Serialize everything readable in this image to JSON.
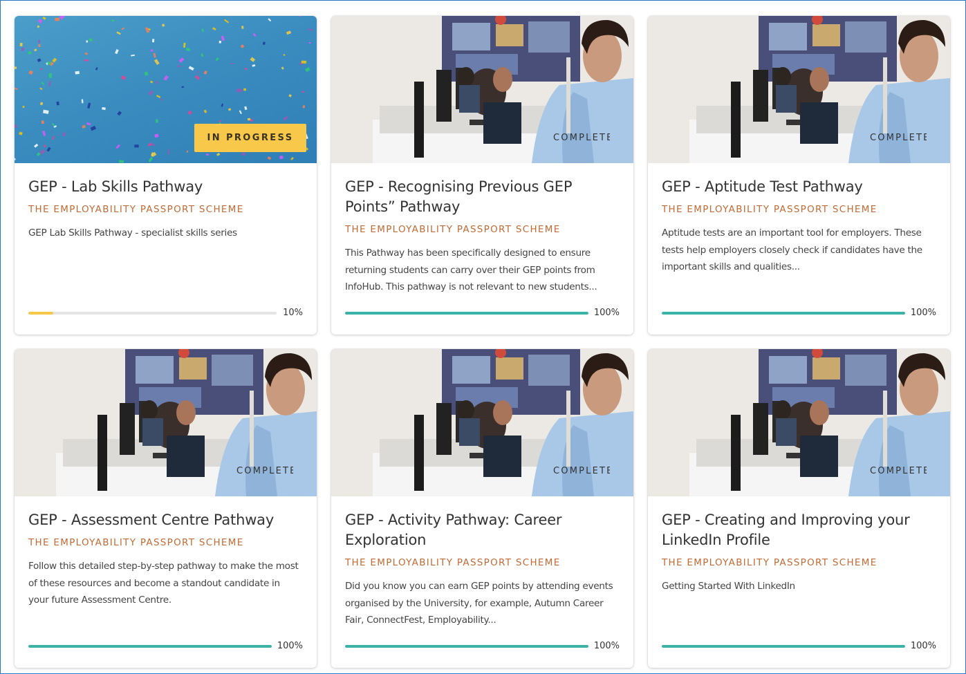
{
  "colors": {
    "scheme_accent": "#c26a33",
    "progress_in": "#f7c84a",
    "progress_done": "#3bb3a8",
    "track": "#e4e4e4",
    "badge_in_progress_bg": "#f7c84a"
  },
  "cards": [
    {
      "image": "confetti-image",
      "badge": "IN PROGRESS",
      "title": "GEP - Lab Skills Pathway",
      "scheme": "THE EMPLOYABILITY PASSPORT SCHEME",
      "description": "GEP Lab Skills Pathway - specialist skills series",
      "progress": 10,
      "progress_label": "10%"
    },
    {
      "image": "classroom-photo",
      "badge": "COMPLETE",
      "title": "GEP - Recognising Previous GEP Points” Pathway",
      "scheme": "THE EMPLOYABILITY PASSPORT SCHEME",
      "description": "This Pathway has been specifically designed to ensure returning students can carry over their GEP points from InfoHub. This pathway is not relevant to new students...",
      "progress": 100,
      "progress_label": "100%"
    },
    {
      "image": "classroom-photo",
      "badge": "COMPLETE",
      "title": "GEP - Aptitude Test Pathway",
      "scheme": "THE EMPLOYABILITY PASSPORT SCHEME",
      "description": "Aptitude tests are an important tool for employers. These tests help employers closely check if candidates have the important skills and qualities...",
      "progress": 100,
      "progress_label": "100%"
    },
    {
      "image": "classroom-photo",
      "badge": "COMPLETE",
      "title": "GEP - Assessment Centre Pathway",
      "scheme": "THE EMPLOYABILITY PASSPORT SCHEME",
      "description": "Follow this detailed step-by-step pathway to make the most of these resources and become a standout candidate in your future Assessment Centre.",
      "progress": 100,
      "progress_label": "100%"
    },
    {
      "image": "classroom-photo",
      "badge": "COMPLETE",
      "title": "GEP - Activity Pathway: Career Exploration",
      "scheme": "THE EMPLOYABILITY PASSPORT SCHEME",
      "description": "Did you know you can earn GEP points by attending events organised by the University, for example, Autumn Career Fair, ConnectFest, Employability...",
      "progress": 100,
      "progress_label": "100%"
    },
    {
      "image": "classroom-photo",
      "badge": "COMPLETE",
      "title": "GEP - Creating and Improving your LinkedIn Profile",
      "scheme": "THE EMPLOYABILITY PASSPORT SCHEME",
      "description": "Getting Started With LinkedIn",
      "progress": 100,
      "progress_label": "100%"
    }
  ]
}
